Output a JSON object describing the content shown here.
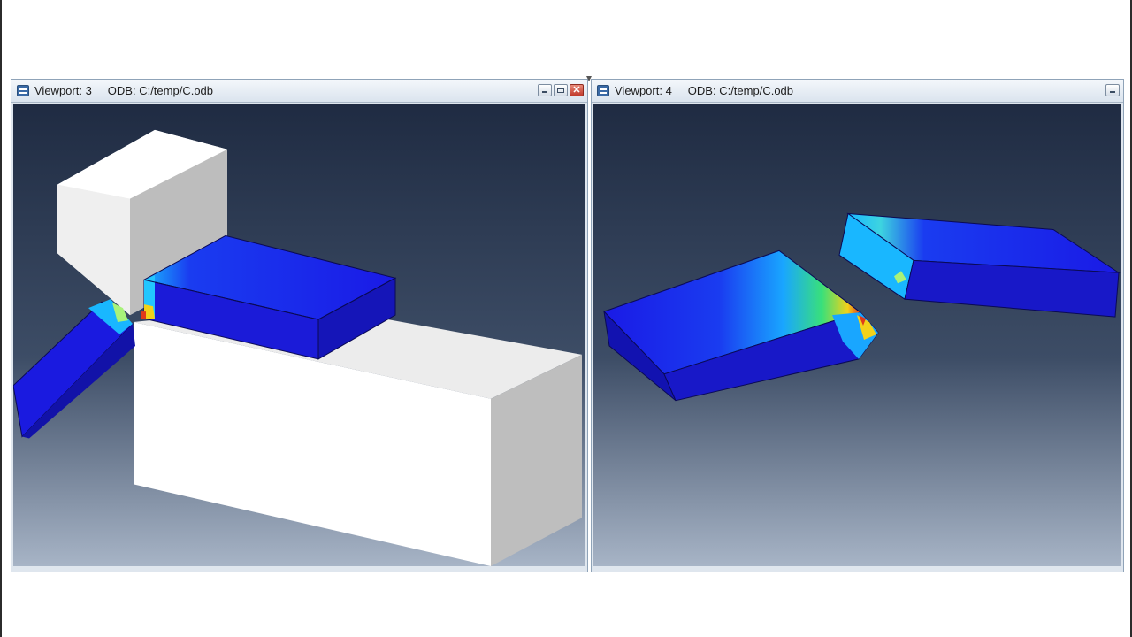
{
  "viewports": [
    {
      "name": "Viewport: 3",
      "odb": "ODB: C:/temp/C.odb",
      "controls": [
        "minimize",
        "maximize",
        "close"
      ]
    },
    {
      "name": "Viewport: 4",
      "odb": "ODB: C:/temp/C.odb",
      "controls": [
        "minimize"
      ]
    }
  ],
  "colors": {
    "background_top": "#1f2b42",
    "background_bottom": "#9aaabf",
    "part_mesh": "#1a1ae0",
    "rigid_body": "#ffffff"
  },
  "icons": [
    "viewport-icon",
    "minimize-icon",
    "maximize-icon",
    "close-icon"
  ]
}
